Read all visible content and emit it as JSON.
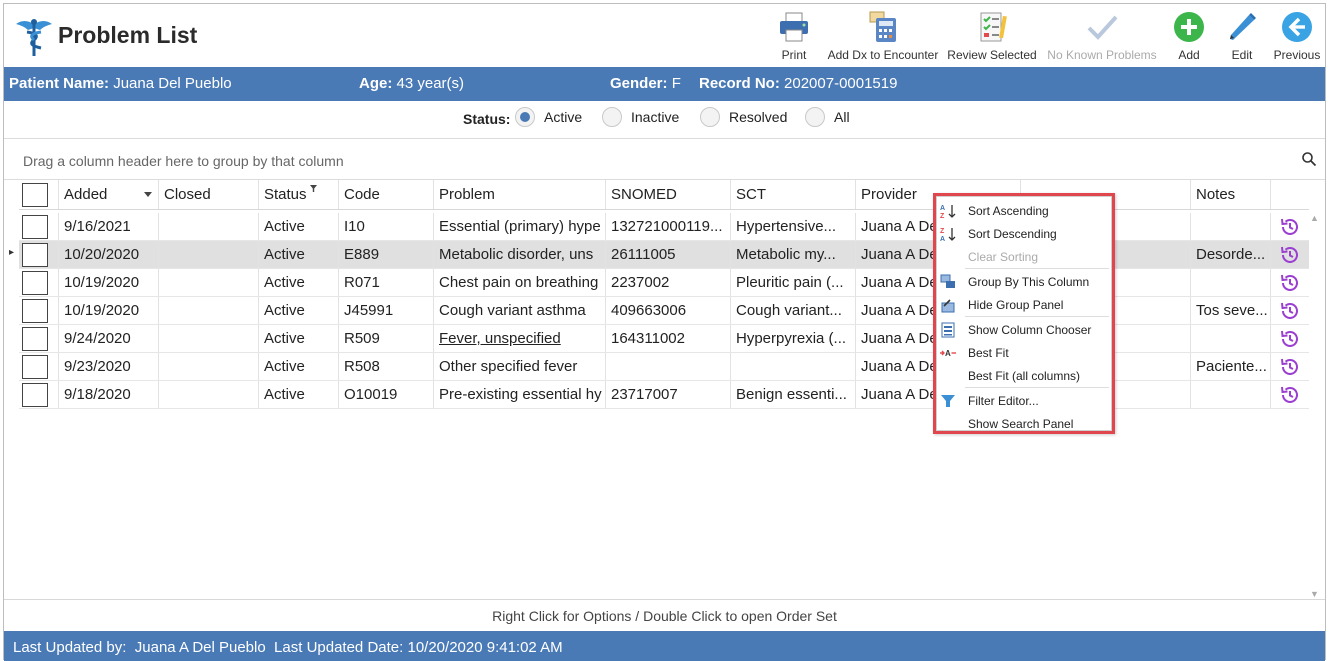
{
  "app": {
    "title": "Problem List"
  },
  "toolbar": [
    {
      "label": "Print",
      "icon": "printer-icon"
    },
    {
      "label": "Add Dx to Encounter",
      "icon": "calculator-icon"
    },
    {
      "label": "Review Selected",
      "icon": "checklist-icon"
    },
    {
      "label": "No Known Problems",
      "icon": "checkmark-icon",
      "disabled": true
    },
    {
      "label": "Add",
      "icon": "plus-circle-icon"
    },
    {
      "label": "Edit",
      "icon": "pencil-icon"
    },
    {
      "label": "Previous",
      "icon": "arrow-left-circle-icon"
    }
  ],
  "patient": {
    "name_label": "Patient Name:",
    "name": "Juana Del Pueblo",
    "age_label": "Age:",
    "age": "43 year(s)",
    "gender_label": "Gender:",
    "gender": "F",
    "record_label": "Record No:",
    "record": "202007-0001519"
  },
  "status_filter": {
    "label": "Status:",
    "options": [
      {
        "label": "Active",
        "selected": true
      },
      {
        "label": "Inactive",
        "selected": false
      },
      {
        "label": "Resolved",
        "selected": false
      },
      {
        "label": "All",
        "selected": false
      }
    ]
  },
  "group_panel": {
    "text": "Drag a column header here to group by that column"
  },
  "columns": [
    "Added",
    "Closed",
    "Status",
    "Code",
    "Problem",
    "SNOMED",
    "SCT",
    "Provider",
    "",
    "Notes"
  ],
  "rows": [
    {
      "added": "9/16/2021",
      "closed": "",
      "status": "Active",
      "code": "I10",
      "problem": "Essential (primary) hype",
      "snomed": "132721000119...",
      "sct": "Hypertensive...",
      "provider": "Juana A De",
      "notes": ""
    },
    {
      "added": "10/20/2020",
      "closed": "",
      "status": "Active",
      "code": "E889",
      "problem": "Metabolic disorder, uns",
      "snomed": "26111005",
      "sct": "Metabolic my...",
      "provider": "Juana A De",
      "notes": "Desorde..."
    },
    {
      "added": "10/19/2020",
      "closed": "",
      "status": "Active",
      "code": "R071",
      "problem": "Chest pain on breathing",
      "snomed": "2237002",
      "sct": "Pleuritic pain (...",
      "provider": "Juana A De",
      "notes": ""
    },
    {
      "added": "10/19/2020",
      "closed": "",
      "status": "Active",
      "code": "J45991",
      "problem": "Cough variant asthma",
      "snomed": "409663006",
      "sct": "Cough variant...",
      "provider": "Juana A De",
      "notes": "Tos seve..."
    },
    {
      "added": "9/24/2020",
      "closed": "",
      "status": "Active",
      "code": "R509",
      "problem": "Fever, unspecified",
      "snomed": "164311002",
      "sct": "Hyperpyrexia (...",
      "provider": "Juana A De",
      "notes": ""
    },
    {
      "added": "9/23/2020",
      "closed": "",
      "status": "Active",
      "code": "R508",
      "problem": "Other specified fever",
      "snomed": "",
      "sct": "",
      "provider": "Juana A De",
      "notes": "Paciente..."
    },
    {
      "added": "9/18/2020",
      "closed": "",
      "status": "Active",
      "code": "O10019",
      "problem": "Pre-existing essential hy",
      "snomed": "23717007",
      "sct": "Benign essenti...",
      "provider": "Juana A De",
      "notes": ""
    }
  ],
  "context_menu": [
    {
      "label": "Sort Ascending",
      "icon": "sort-ascending-icon"
    },
    {
      "label": "Sort Descending",
      "icon": "sort-descending-icon"
    },
    {
      "label": "Clear Sorting",
      "disabled": true
    },
    {
      "label": "Group By This Column",
      "icon": "group-by-icon"
    },
    {
      "label": "Hide Group Panel",
      "icon": "hide-group-panel-icon"
    },
    {
      "label": "Show Column Chooser",
      "icon": "column-chooser-icon"
    },
    {
      "label": "Best Fit",
      "icon": "best-fit-icon"
    },
    {
      "label": "Best Fit (all columns)"
    },
    {
      "label": "Filter Editor...",
      "icon": "filter-icon"
    },
    {
      "label": "Show Search Panel"
    }
  ],
  "hint": "Right Click for Options / Double Click to open Order Set",
  "footer": {
    "updated_by_label": "Last Updated by:",
    "updated_by": "Juana A Del Pueblo",
    "updated_date_label": "Last Updated Date:",
    "updated_date": "10/20/2020 9:41:02 AM"
  },
  "colors": {
    "accent": "#4a7ab5",
    "menu_border": "#e0464e",
    "history_icon": "#9b3fd1",
    "add_green": "#3cb54a",
    "prev_blue": "#3aa3e3"
  }
}
